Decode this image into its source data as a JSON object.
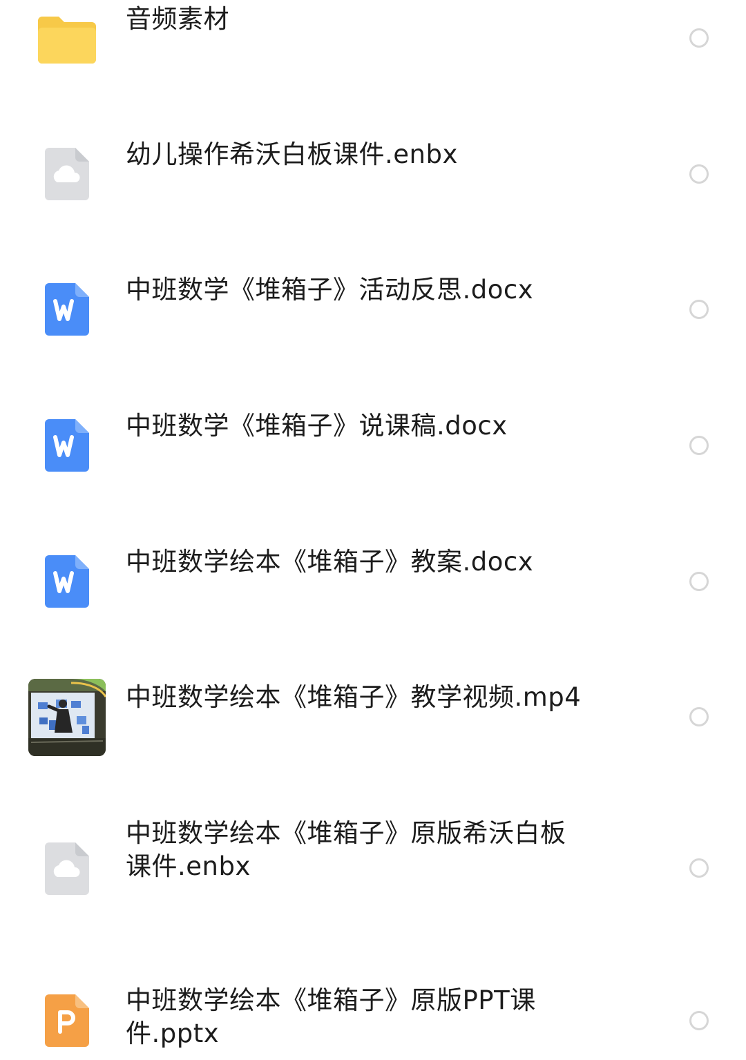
{
  "files": {
    "items": [
      {
        "name": "音频素材",
        "icon": "folder-icon"
      },
      {
        "name": "幼儿操作希沃白板课件.enbx",
        "icon": "cloud-file-icon"
      },
      {
        "name": "中班数学《堆箱子》活动反思.docx",
        "icon": "word-doc-icon"
      },
      {
        "name": "中班数学《堆箱子》说课稿.docx",
        "icon": "word-doc-icon"
      },
      {
        "name": "中班数学绘本《堆箱子》教案.docx",
        "icon": "word-doc-icon"
      },
      {
        "name": "中班数学绘本《堆箱子》教学视频.mp4",
        "icon": "video-thumbnail"
      },
      {
        "name": "中班数学绘本《堆箱子》原版希沃白板\n课件.enbx",
        "icon": "cloud-file-icon"
      },
      {
        "name": "中班数学绘本《堆箱子》原版PPT课件.pptx",
        "icon": "ppt-file-icon"
      }
    ]
  },
  "colors": {
    "folder": "#FCD65C",
    "cloud_file": "#DCDDE0",
    "word": "#4A8DF8",
    "ppt": "#F5A046",
    "check_ring": "#D6D6D6"
  }
}
